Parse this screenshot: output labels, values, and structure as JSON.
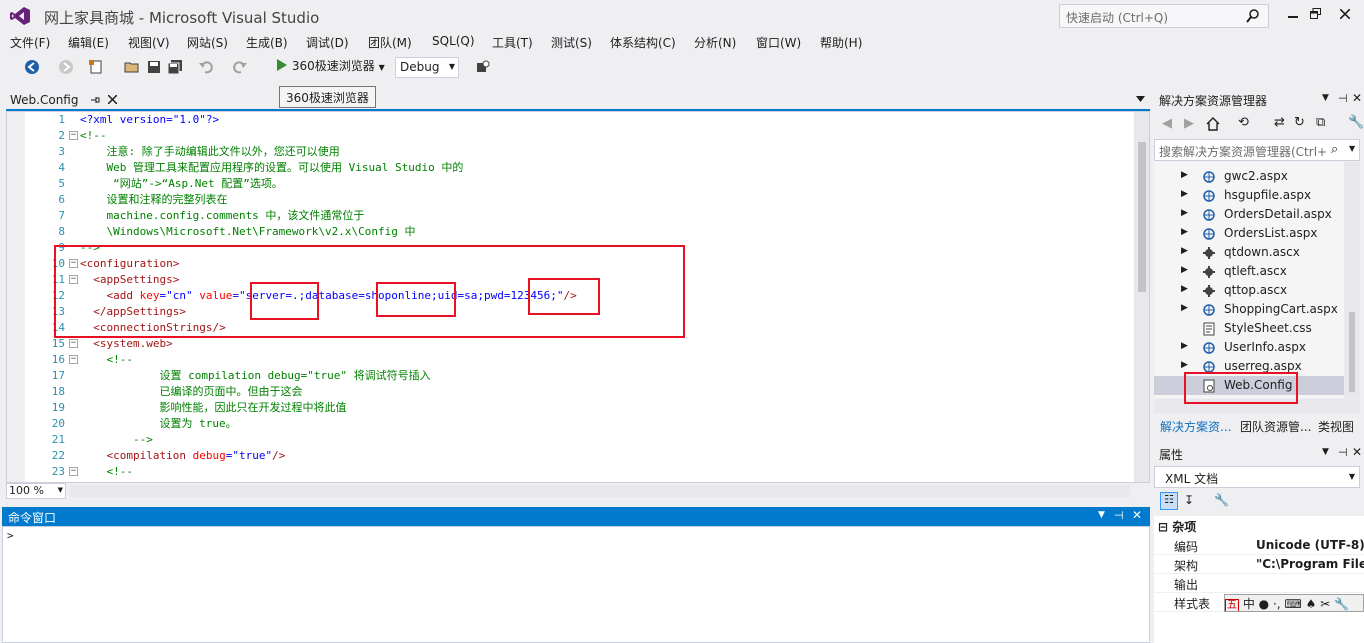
{
  "window": {
    "title": "网上家具商城 - Microsoft Visual Studio",
    "quick_launch_placeholder": "快速启动 (Ctrl+Q)"
  },
  "menu": [
    "文件(F)",
    "编辑(E)",
    "视图(V)",
    "网站(S)",
    "生成(B)",
    "调试(D)",
    "团队(M)",
    "SQL(Q)",
    "工具(T)",
    "测试(S)",
    "体系结构(C)",
    "分析(N)",
    "窗口(W)",
    "帮助(H)"
  ],
  "toolbar": {
    "run_label": "360极速浏览器",
    "configuration": "Debug",
    "tooltip": "360极速浏览器"
  },
  "editor": {
    "tab_label": "Web.Config",
    "zoom": "100 %",
    "lines": [
      {
        "n": "1"
      },
      {
        "n": "2"
      },
      {
        "n": "3"
      },
      {
        "n": "4"
      },
      {
        "n": "5"
      },
      {
        "n": "6"
      },
      {
        "n": "7"
      },
      {
        "n": "8"
      },
      {
        "n": "9"
      },
      {
        "n": "10"
      },
      {
        "n": "11"
      },
      {
        "n": "12"
      },
      {
        "n": "13"
      },
      {
        "n": "14"
      },
      {
        "n": "15"
      },
      {
        "n": "16"
      },
      {
        "n": "17"
      },
      {
        "n": "18"
      },
      {
        "n": "19"
      },
      {
        "n": "20"
      },
      {
        "n": "21"
      },
      {
        "n": "22"
      },
      {
        "n": "23"
      }
    ],
    "code": {
      "l1_pi": "<?xml version=\"1.0\"?>",
      "l2": "<!--",
      "l3": "    注意: 除了手动编辑此文件以外，您还可以使用",
      "l4": "    Web 管理工具来配置应用程序的设置。可以使用 Visual Studio 中的",
      "l5": "     “网站”->“Asp.Net 配置”选项。",
      "l6": "    设置和注释的完整列表在",
      "l7": "    machine.config.comments 中，该文件通常位于",
      "l8": "    \\Windows\\Microsoft.Net\\Framework\\v2.x\\Config 中",
      "l9": "-->",
      "l10_tag": "<configuration>",
      "l11_tag": "  <appSettings>",
      "l12_tag_open": "    <add ",
      "l12_attr_key": "key",
      "l12_eq1": "=",
      "l12_val_key": "\"cn\"",
      "l12_attr_value": " value",
      "l12_eq2": "=",
      "l12_val_value": "\"server=.;database=shoponline;uid=sa;pwd=123456;\"",
      "l12_close": "/>",
      "l13_tag": "  </appSettings>",
      "l14_tag": "  <connectionStrings/>",
      "l15_tag": "  <system.web>",
      "l16": "    <!--",
      "l17": "            设置 compilation debug=\"true\" 将调试符号插入",
      "l18": "            已编译的页面中。但由于这会",
      "l19": "            影响性能，因此只在开发过程中将此值",
      "l20": "            设置为 true。",
      "l21": "        -->",
      "l22_tag": "    <compilation ",
      "l22_attr": "debug",
      "l22_eq": "=",
      "l22_val": "\"true\"",
      "l22_close": "/>",
      "l23": "    <!--"
    }
  },
  "command_window": {
    "title": "命令窗口",
    "prompt": ">"
  },
  "solution_explorer": {
    "title": "解决方案资源管理器",
    "search_placeholder": "搜索解决方案资源管理器(Ctrl+",
    "items": [
      {
        "label": "gwc2.aspx",
        "icon": "aspx-page-icon"
      },
      {
        "label": "hsgupfile.aspx",
        "icon": "aspx-page-icon"
      },
      {
        "label": "OrdersDetail.aspx",
        "icon": "aspx-page-icon"
      },
      {
        "label": "OrdersList.aspx",
        "icon": "aspx-page-icon"
      },
      {
        "label": "qtdown.ascx",
        "icon": "user-control-icon"
      },
      {
        "label": "qtleft.ascx",
        "icon": "user-control-icon"
      },
      {
        "label": "qttop.ascx",
        "icon": "user-control-icon"
      },
      {
        "label": "ShoppingCart.aspx",
        "icon": "aspx-page-icon"
      },
      {
        "label": "StyleSheet.css",
        "icon": "stylesheet-icon"
      },
      {
        "label": "UserInfo.aspx",
        "icon": "aspx-page-icon"
      },
      {
        "label": "userreg.aspx",
        "icon": "aspx-page-icon"
      },
      {
        "label": "Web.Config",
        "icon": "config-file-icon"
      }
    ],
    "tabs": [
      "解决方案资...",
      "团队资源管...",
      "类视图"
    ]
  },
  "properties": {
    "title": "属性",
    "object": "XML 文档",
    "category": "杂项",
    "rows": [
      {
        "name": "编码",
        "value": "Unicode (UTF-8)"
      },
      {
        "name": "架构",
        "value": "\"C:\\Program File"
      },
      {
        "name": "输出",
        "value": ""
      },
      {
        "name": "样式表",
        "value": ""
      }
    ],
    "ime_chars": "中"
  },
  "colors": {
    "accent": "#007ACC",
    "highlight_box": "#E81123"
  }
}
